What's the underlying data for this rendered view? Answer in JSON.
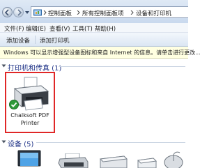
{
  "address_bar": {
    "crumbs": [
      "控制面板",
      "所有控制面板项",
      "设备和打印机"
    ]
  },
  "menu": {
    "items": [
      "文件(F)",
      "编辑(E)",
      "查看(V)",
      "工具(T)",
      "帮助(H)"
    ]
  },
  "commands": {
    "add_device": "添加设备",
    "add_printer": "添加打印机"
  },
  "info_bar": {
    "text": "Windows 可以显示增强型设备图标和来自 Internet 的信息。请单击进行更改..."
  },
  "groups": {
    "printers": {
      "title": "打印机和传真 (1)",
      "devices": [
        {
          "name_line1": "Chalksoft PDF",
          "name_line2": "Printer",
          "icon": "printer-icon",
          "status_icon": "check-icon"
        }
      ]
    },
    "devices": {
      "title": "设备 (5)",
      "icons": [
        "laptop-icon",
        "printer-icon",
        "scanner-icon",
        "drive-icon",
        "mouse-icon"
      ]
    }
  },
  "colors": {
    "header_text": "#1e3287",
    "highlight_border": "#e02727",
    "info_bar_bg": "#ffffe1"
  }
}
